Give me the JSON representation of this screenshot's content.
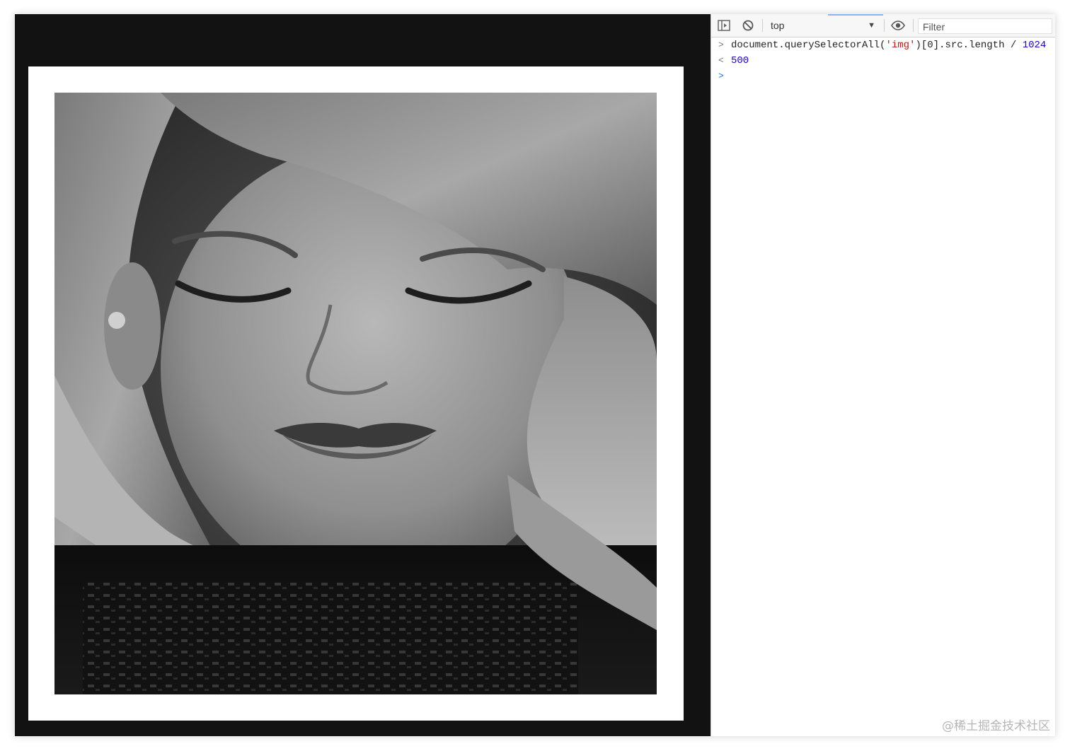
{
  "devtools": {
    "context_selector": "top",
    "filter_placeholder": "Filter",
    "console": {
      "input_prompt": ">",
      "output_prompt": "<",
      "code_part1": "document.querySelectorAll(",
      "code_string": "'img'",
      "code_part2": ")[0].src.length / ",
      "code_number": "1024",
      "result": "500",
      "next_prompt": ">"
    }
  },
  "watermark": "@稀土掘金技术社区",
  "icons": {
    "dock": "dock-side-icon",
    "clear": "clear-console-icon",
    "dropdown": "chevron-down-icon",
    "eye": "eye-icon"
  },
  "colors": {
    "viewport_bg": "#121212",
    "frame_bg": "#ffffff",
    "string": "#c41a16",
    "number": "#1c00cf",
    "active_tab": "#8ab4f8"
  }
}
